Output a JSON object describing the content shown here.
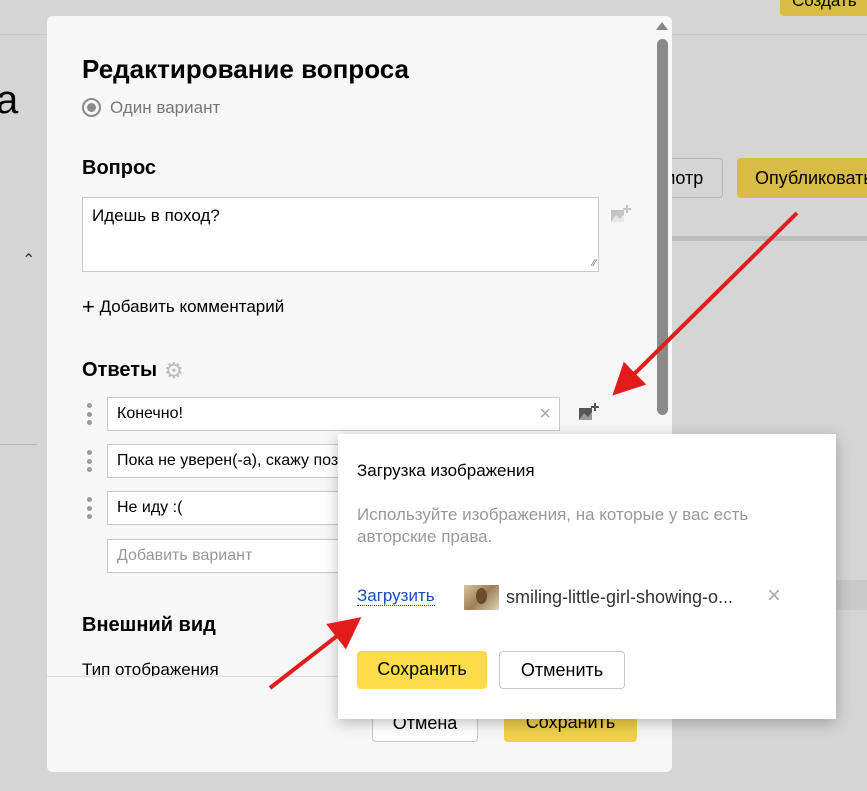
{
  "background": {
    "top_button": "Создать",
    "heading_fragment": "а",
    "preview_button": "мотр",
    "publish_button": "Опубликовать"
  },
  "modal": {
    "title": "Редактирование вопроса",
    "question_type": "Один вариант",
    "question_heading": "Вопрос",
    "question_text": "Идешь в поход?",
    "add_comment": "Добавить комментарий",
    "answers_heading": "Ответы",
    "answers": [
      "Конечно!",
      "Пока не уверен(-а), скажу позже",
      "Не иду :("
    ],
    "add_variant_placeholder": "Добавить вариант",
    "appearance_heading": "Внешний вид",
    "display_type_label": "Тип отображения",
    "cancel": "Отмена",
    "save": "Сохранить"
  },
  "popup": {
    "title": "Загрузка изображения",
    "hint": "Используйте изображения, на которые у вас есть авторские права.",
    "upload_link": "Загрузить",
    "file_name": "smiling-little-girl-showing-o...",
    "save": "Сохранить",
    "cancel": "Отменить"
  },
  "colors": {
    "accent": "#fddc4a",
    "link": "#1a4cb3",
    "arrow": "#e21b1b"
  }
}
